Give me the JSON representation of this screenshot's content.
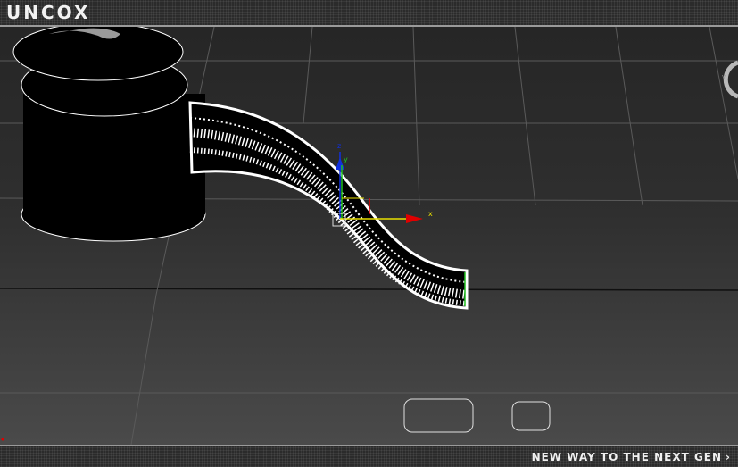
{
  "header": {
    "brand": "UNCOX"
  },
  "footer": {
    "tagline": "NEW WAY TO THE NEXT GEN",
    "arrow": "›"
  },
  "gizmo": {
    "axis_x_label": "x",
    "axis_y_label": "y",
    "axis_z_label": "z"
  },
  "colors": {
    "axis_x": "#e00000",
    "axis_y": "#e8e000",
    "axis_z": "#1030e0",
    "handle_green": "#20c020"
  },
  "icons": {
    "viewcube": "viewcube-ring-icon"
  }
}
